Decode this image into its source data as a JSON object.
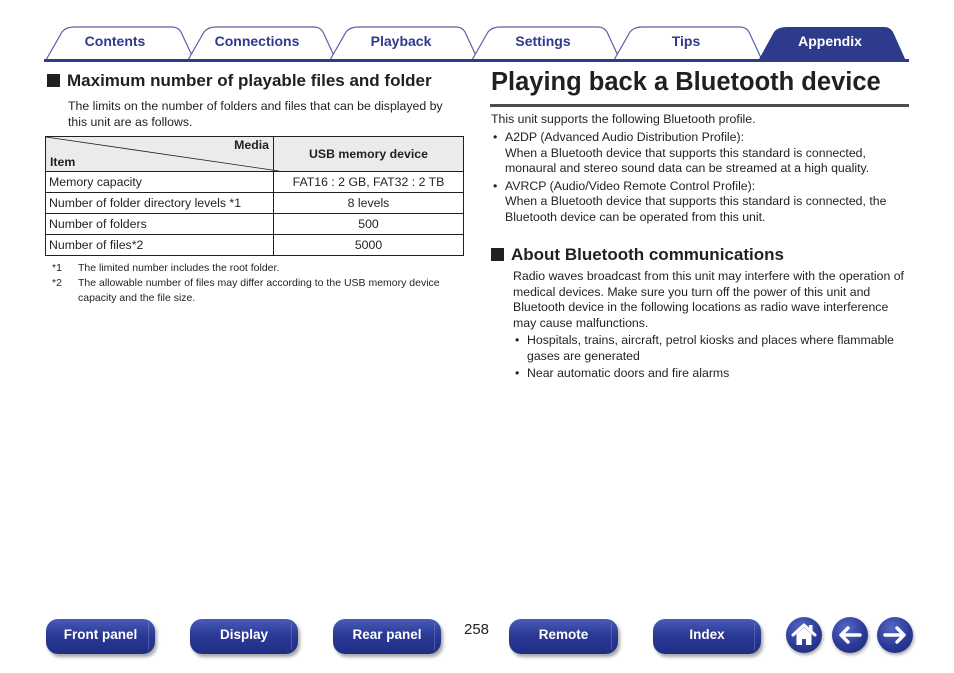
{
  "tabs": [
    {
      "label": "Contents",
      "active": false
    },
    {
      "label": "Connections",
      "active": false
    },
    {
      "label": "Playback",
      "active": false
    },
    {
      "label": "Settings",
      "active": false
    },
    {
      "label": "Tips",
      "active": false
    },
    {
      "label": "Appendix",
      "active": true
    }
  ],
  "colors": {
    "brand_blue": "#2e3a8c",
    "tab_active_bg": "#2e3a8c",
    "text": "#231f20",
    "table_header_bg": "#ebebeb"
  },
  "left": {
    "heading": "Maximum number of playable files and folder",
    "intro": "The limits on the number of folders and files that can be displayed by this unit are as follows.",
    "table": {
      "header_media": "Media",
      "header_item": "Item",
      "header_column": "USB memory device",
      "rows": [
        {
          "item": "Memory capacity",
          "value": "FAT16 : 2 GB, FAT32 : 2 TB"
        },
        {
          "item": "Number of folder directory levels *1",
          "value": "8 levels"
        },
        {
          "item": "Number of folders",
          "value": "500"
        },
        {
          "item": "Number of files*2",
          "value": "5000"
        }
      ]
    },
    "footnotes": [
      {
        "mark": "*1",
        "text": "The limited number includes the root folder."
      },
      {
        "mark": "*2",
        "text": "The allowable number of files may differ according to the USB memory device capacity and the file size."
      }
    ]
  },
  "right": {
    "title": "Playing back a Bluetooth device",
    "intro": "This unit supports the following Bluetooth profile.",
    "profiles": [
      {
        "name": "A2DP (Advanced Audio Distribution Profile):",
        "desc": "When a Bluetooth device that supports this standard is connected, monaural and stereo sound data can be streamed at a high quality."
      },
      {
        "name": "AVRCP (Audio/Video Remote Control Profile):",
        "desc": "When a Bluetooth device that supports this standard is connected, the Bluetooth device can be operated from this unit."
      }
    ],
    "comm_heading": "About Bluetooth communications",
    "comm_text": "Radio waves broadcast from this unit may interfere with the operation of medical devices. Make sure you turn off the power of this unit and Bluetooth device in the following locations as radio wave interference may cause malfunctions.",
    "comm_bullets": [
      "Hospitals, trains, aircraft, petrol kiosks and places where flammable gases are generated",
      "Near automatic doors and fire alarms"
    ],
    "bullet_glyph": "•"
  },
  "footer": {
    "buttons": [
      "Front panel",
      "Display",
      "Rear panel",
      "Remote",
      "Index"
    ],
    "page_number": "258",
    "icons": {
      "home": "home-icon",
      "back": "arrow-left-icon",
      "forward": "arrow-right-icon"
    }
  }
}
